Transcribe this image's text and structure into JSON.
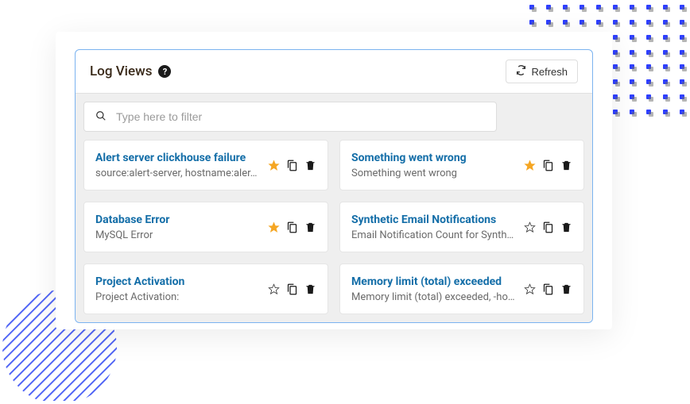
{
  "header": {
    "title": "Log Views",
    "help_tooltip": "?",
    "refresh_label": "Refresh"
  },
  "filter": {
    "placeholder": "Type here to filter"
  },
  "cards": [
    {
      "title": "Alert server clickhouse failure",
      "desc": "source:alert-server, hostname:aler…",
      "starred": true
    },
    {
      "title": "Something went wrong",
      "desc": "Something went wrong",
      "starred": true
    },
    {
      "title": "Database Error",
      "desc": "MySQL Error",
      "starred": true
    },
    {
      "title": "Synthetic Email Notifications",
      "desc": "Email Notification Count for Synth…",
      "starred": false
    },
    {
      "title": "Project Activation",
      "desc": "Project Activation:",
      "starred": false
    },
    {
      "title": "Memory limit (total) exceeded",
      "desc": "Memory limit (total) exceeded, -ho…",
      "starred": false
    }
  ]
}
